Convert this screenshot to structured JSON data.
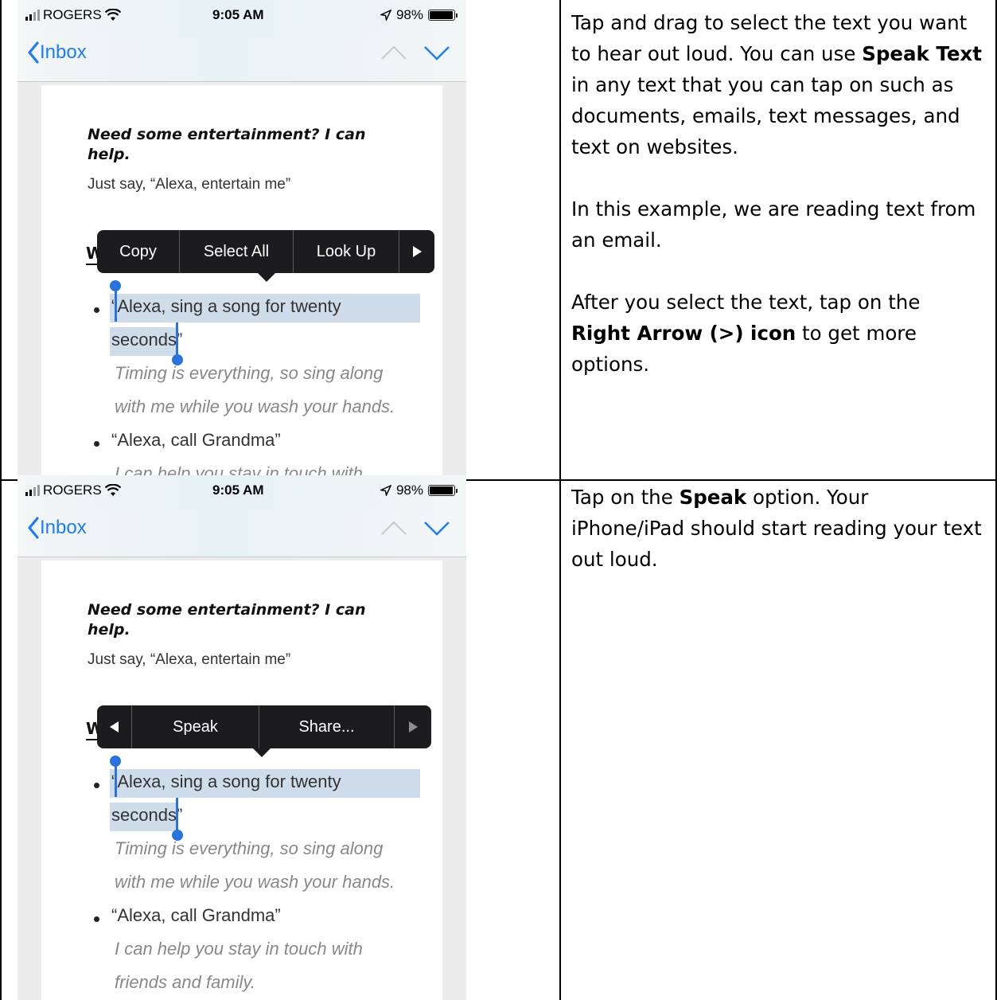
{
  "phone": {
    "carrier": "ROGERS",
    "time": "9:05 AM",
    "battery": "98%",
    "battery_level": 0.98,
    "back_label": "Inbox",
    "email": {
      "heading": "Need some entertainment? I can help.",
      "subtext": "Just say, “Alexa, entertain me”",
      "section_initial": "W",
      "bullet1_line1": "“Alexa, sing a song for twenty",
      "bullet1_line2": "seconds”",
      "italic1_line1": "Timing is everything, so sing along",
      "italic1_line2": "with me while you wash your hands.",
      "bullet2": "“Alexa, call Grandma”",
      "italic2_line1": "I can help you stay in touch with",
      "italic2_line2": "friends and family."
    }
  },
  "menu1": {
    "copy": "Copy",
    "select_all": "Select All",
    "look_up": "Look Up",
    "next_icon": "right-triangle-icon"
  },
  "menu2": {
    "speak": "Speak",
    "share": "Share...",
    "prev_icon": "left-triangle-icon",
    "next_icon": "right-triangle-icon"
  },
  "instructions": {
    "row1": {
      "p1_a": "Tap and drag to select the text you want to hear out loud. You can use ",
      "p1_bold": "Speak Text",
      "p1_b": " in any text that you can tap on such as documents, emails, text messages, and text on websites.",
      "p2": "In this example, we are reading text from an email.",
      "p3_a": "After you select the text, tap on the ",
      "p3_bold": "Right Arrow (>) icon",
      "p3_b": " to get more options."
    },
    "row2": {
      "p1_a": "Tap on the ",
      "p1_bold": "Speak",
      "p1_b": " option. Your iPhone/iPad should start reading your text out loud."
    }
  }
}
